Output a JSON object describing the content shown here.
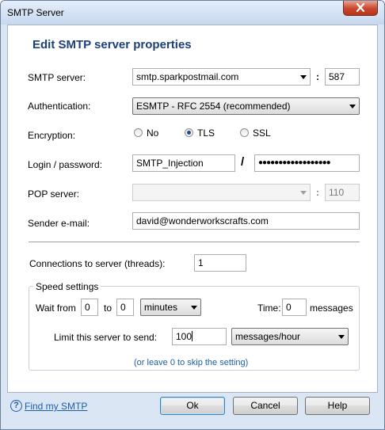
{
  "window": {
    "title": "SMTP Server"
  },
  "heading": "Edit SMTP server properties",
  "smtp_server": {
    "label": "SMTP server:",
    "value": "smtp.sparkpostmail.com",
    "colon": ":",
    "port": "587"
  },
  "authentication": {
    "label": "Authentication:",
    "value": "ESMTP - RFC 2554 (recommended)"
  },
  "encryption": {
    "label": "Encryption:",
    "options": [
      "No",
      "TLS",
      "SSL"
    ],
    "selected": "TLS"
  },
  "login": {
    "label": "Login / password:",
    "value": "SMTP_Injection",
    "slash": "/",
    "password_mask": "●●●●●●●●●●●●●●●●●●"
  },
  "pop_server": {
    "label": "POP server:",
    "value": "",
    "colon": ":",
    "port": "110"
  },
  "sender": {
    "label": "Sender e-mail:",
    "value": "david@wonderworkscrafts.com"
  },
  "connections": {
    "label": "Connections to server (threads):",
    "value": "1"
  },
  "speed": {
    "title": "Speed settings",
    "wait_from_label": "Wait from",
    "wait_from": "0",
    "to_label": "to",
    "wait_to": "0",
    "unit": "minutes",
    "time_label": "Time:",
    "time_value": "0",
    "messages_label": "messages",
    "limit_label": "Limit this server to send:",
    "limit_value": "100",
    "limit_unit": "messages/hour",
    "hint": "(or leave 0 to skip the setting)"
  },
  "footer": {
    "help_glyph": "?",
    "find_link": "Find my SMTP",
    "ok": "Ok",
    "cancel": "Cancel",
    "help": "Help"
  },
  "colors": {
    "heading": "#1d3f7a",
    "link": "#1d5ea8",
    "close": "#c9462c"
  }
}
